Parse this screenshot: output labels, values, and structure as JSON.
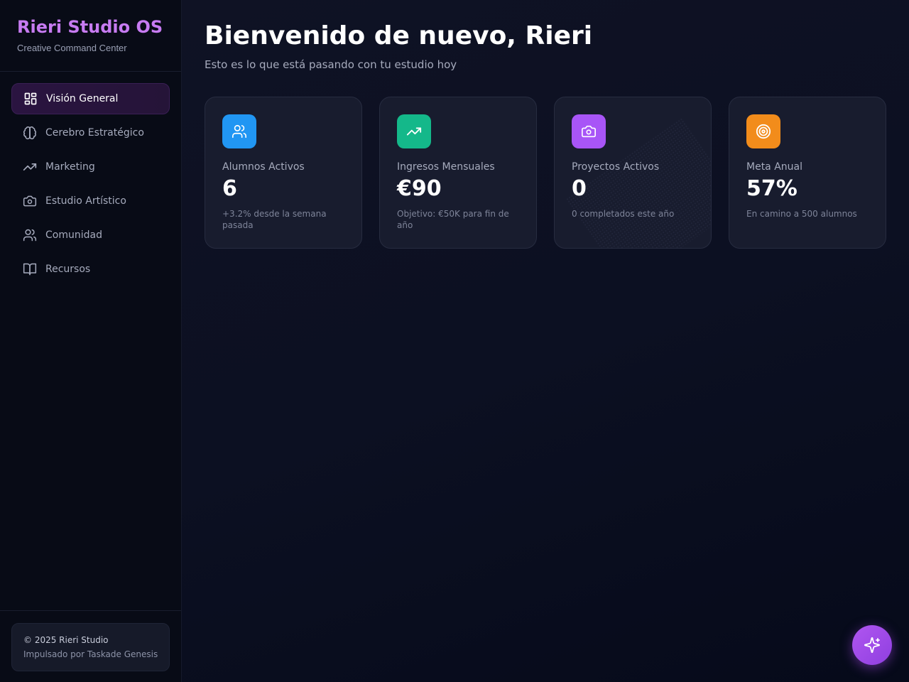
{
  "sidebar": {
    "brand_title": "Rieri Studio OS",
    "brand_subtitle": "Creative Command Center",
    "items": [
      {
        "label": "Visión General",
        "icon": "layout-dashboard-icon",
        "active": true
      },
      {
        "label": "Cerebro Estratégico",
        "icon": "brain-icon",
        "active": false
      },
      {
        "label": "Marketing",
        "icon": "trending-up-icon",
        "active": false
      },
      {
        "label": "Estudio Artístico",
        "icon": "camera-icon",
        "active": false
      },
      {
        "label": "Comunidad",
        "icon": "users-icon",
        "active": false
      },
      {
        "label": "Recursos",
        "icon": "book-open-icon",
        "active": false
      }
    ],
    "footer": {
      "copyright": "© 2025 Rieri Studio",
      "powered_by": "Impulsado por Taskade Genesis"
    }
  },
  "header": {
    "title": "Bienvenido de nuevo, Rieri",
    "subtitle": "Esto es lo que está pasando con tu estudio hoy"
  },
  "stats": [
    {
      "label": "Alumnos Activos",
      "value": "6",
      "note": "+3.2% desde la semana pasada",
      "icon": "users-icon",
      "color": "#2196f3"
    },
    {
      "label": "Ingresos Mensuales",
      "value": "€90",
      "note": "Objetivo: €50K para fin de año",
      "icon": "trending-up-icon",
      "color": "#14b88a"
    },
    {
      "label": "Proyectos Activos",
      "value": "0",
      "note": "0 completados este año",
      "icon": "camera-icon",
      "color": "#a855f7"
    },
    {
      "label": "Meta Anual",
      "value": "57%",
      "note": "En camino a 500 alumnos",
      "icon": "target-icon",
      "color": "#f28c1b"
    }
  ],
  "fab": {
    "icon": "sparkles-icon"
  },
  "theme": {
    "accent": "#c77bf2",
    "background": "#0b0f1e"
  }
}
